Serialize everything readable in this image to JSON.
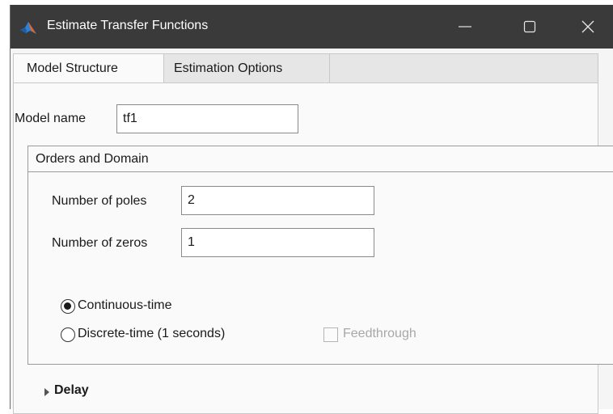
{
  "window": {
    "title": "Estimate Transfer Functions",
    "app_icon": "matlab-icon",
    "controls": [
      "minimize-icon",
      "maximize-icon",
      "close-icon"
    ]
  },
  "tabs": [
    {
      "label": "Model Structure",
      "selected": true
    },
    {
      "label": "Estimation Options",
      "selected": false
    }
  ],
  "model_name": {
    "label": "Model name",
    "value": "tf1"
  },
  "orders_domain": {
    "title": "Orders and Domain",
    "poles_label": "Number of poles",
    "poles_value": "2",
    "zeros_label": "Number of zeros",
    "zeros_value": "1",
    "continuous_label": "Continuous-time",
    "continuous_selected": true,
    "discrete_label": "Discrete-time (1 seconds)",
    "discrete_selected": false,
    "feedthrough_label": "Feedthrough",
    "feedthrough_checked": false,
    "feedthrough_enabled": false
  },
  "delay": {
    "label": "Delay",
    "expanded": false
  },
  "colors": {
    "titlebar": "#3a3a3a",
    "panel": "#fafafa",
    "disabled_text": "#a8a8a8"
  }
}
